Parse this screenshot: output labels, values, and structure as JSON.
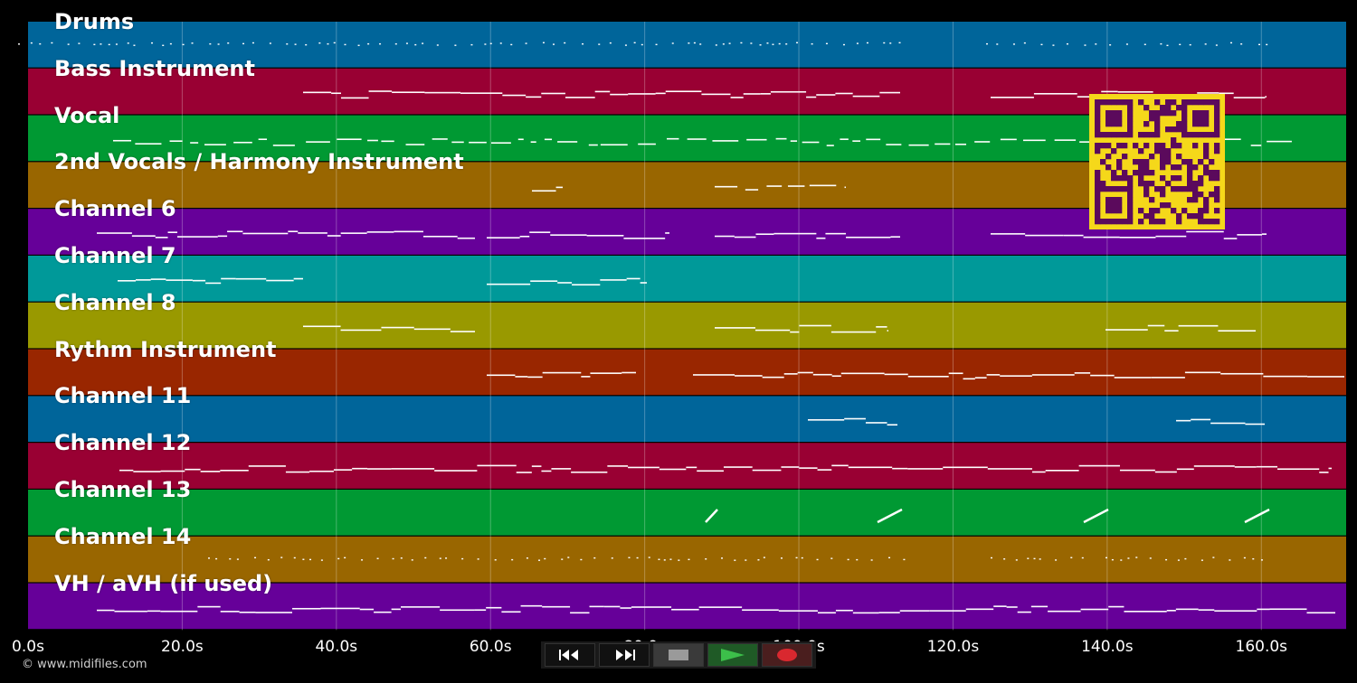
{
  "tracks": [
    {
      "name": "Drums",
      "color": "#00659a"
    },
    {
      "name": "Bass Instrument",
      "color": "#990033"
    },
    {
      "name": "Vocal",
      "color": "#009933"
    },
    {
      "name": "2nd Vocals / Harmony Instrument",
      "color": "#996600"
    },
    {
      "name": "Channel 6",
      "color": "#660099"
    },
    {
      "name": "Channel 7",
      "color": "#009999"
    },
    {
      "name": "Channel 8",
      "color": "#999900"
    },
    {
      "name": "Rythm Instrument",
      "color": "#992600"
    },
    {
      "name": "Channel 11",
      "color": "#00659a"
    },
    {
      "name": "Channel 12",
      "color": "#990033"
    },
    {
      "name": "Channel 13",
      "color": "#009933"
    },
    {
      "name": "Channel 14",
      "color": "#996600"
    },
    {
      "name": "VH / aVH (if used)",
      "color": "#660099"
    }
  ],
  "time_axis": {
    "ticks": [
      "0.0s",
      "20.0s",
      "40.0s",
      "60.0s",
      "80.0s",
      "100.0s",
      "120.0s",
      "140.0s",
      "160.0s"
    ],
    "max_seconds": 171
  },
  "copyright": "© www.midifiles.com",
  "transport": {
    "rewind_icon": "rewind-icon",
    "fastforward_icon": "fast-forward-icon",
    "stop_icon": "stop-icon",
    "play_icon": "play-icon",
    "record_icon": "record-icon"
  },
  "colors": {
    "background": "#000000",
    "qr_fg": "#5b0a5c",
    "qr_bg": "#f5d81a",
    "play": "#3cbf4a",
    "record": "#d9282f"
  }
}
